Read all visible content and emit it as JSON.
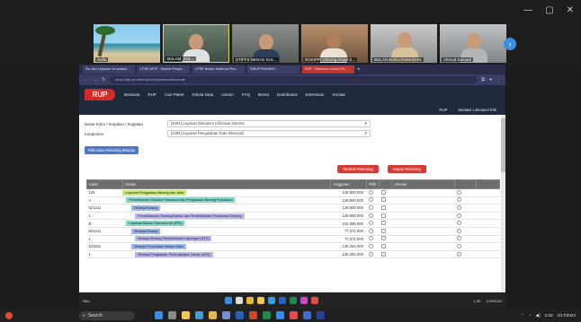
{
  "vc": {
    "participants": [
      {
        "name": "Sulfa",
        "scene": "beach"
      },
      {
        "name": "BALAM_SUL...",
        "scene": "room1"
      },
      {
        "name": "STIFFS NENAS SUL...",
        "scene": "room2"
      },
      {
        "name": "ROKIPPI Cheong Amad S...",
        "scene": "room3"
      },
      {
        "name": "BULAN BUKU RAMADAN",
        "scene": "room4"
      },
      {
        "name": "Ahmad Kamadi",
        "scene": "room5"
      }
    ]
  },
  "browser": {
    "tabs": [
      "Siz dan Layanan Ini adalah...",
      "LPSE APIP - Sistem Penya...",
      "LPSE Badan Nasional Pen...",
      "SIRUP/PAMIS/D...",
      "RUP - Rencana Umum Pe..."
    ],
    "url": "sirup.lkpp.go.id/sirup/ro/rup/penyedia/create",
    "nav": {
      "logo": "RUP",
      "menu": [
        "Beranda",
        "RUP",
        "Cari Paket",
        "Kelola Data",
        "Unduh",
        "FAQ",
        "Berita",
        "Dashboard",
        "Ketentuan",
        "Kontak"
      ],
      "rup_label": "RUP",
      "user_label": "Sanitasi Lukmanul Khk"
    },
    "filters": {
      "label1": "Dasar Kirim / Kerjakan / Kegiatan",
      "value1": "[4294] Layanan Dokumen Informasi Internet",
      "label2": "Komponen",
      "value2": "[4294] Layanan Pengolahan Data Informasi",
      "button": "Pilih Data Rekening Belanja"
    },
    "actions": {
      "btn1": "Tambah Rekening",
      "btn2": "Hapus Rekening"
    },
    "table": {
      "headers": [
        "Kode",
        "Uraian",
        "Anggaran",
        "Pilih",
        "",
        "Volume",
        "",
        ""
      ],
      "rows": [
        {
          "code": "125",
          "desc": "Layanan Pengadaan Barang dan Jasa",
          "tag": "lime",
          "amount": "216.800.000"
        },
        {
          "code": "A",
          "desc": "Pemeliharaan Sarana Prasarana dan Pengadaan Barang Prasarana",
          "tag": "teal",
          "amount": "128.800.000"
        },
        {
          "code": "521211",
          "desc": "Belanja Barang",
          "tag": "blue",
          "amount": "128.800.000"
        },
        {
          "code": "1",
          "desc": "Pemeliharaan Gedung/Kantor dan Pemeliharaan Prasarana Gedung",
          "tag": "lav",
          "amount": "128.800.000"
        },
        {
          "code": "B",
          "desc": "Layanan Bahan Operasional (ATK)",
          "tag": "teal",
          "amount": "102.800.000"
        },
        {
          "code": "521211",
          "desc": "Belanja Barang",
          "tag": "blue",
          "amount": "77.371.000"
        },
        {
          "code": "1",
          "desc": "Belanja Barang Pemeliharaan Lapangan (ATK)",
          "tag": "lav",
          "amount": "77.371.000"
        },
        {
          "code": "521811",
          "desc": "Belanja Persediaan Bahan Baku",
          "tag": "blue",
          "amount": "136.252.000"
        },
        {
          "code": "1",
          "desc": "Belanja Pengadaan Perlengkapan Kantor (ATK)",
          "tag": "lav",
          "amount": "136.252.000"
        }
      ]
    },
    "inner_taskbar": {
      "left_label": "Siku",
      "time": "1:59",
      "date": "1/16/2024"
    }
  },
  "taskbar": {
    "search_label": "Search",
    "time": "2:03",
    "date": "1/17/2024"
  }
}
